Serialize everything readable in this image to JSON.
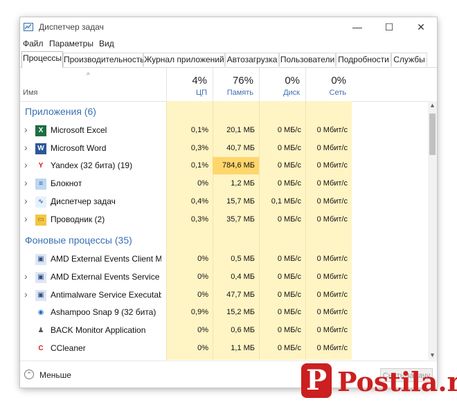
{
  "window": {
    "title": "Диспетчер задач"
  },
  "controls": {
    "minimize": "—",
    "maximize": "☐",
    "close": "✕"
  },
  "menu": [
    "Файл",
    "Параметры",
    "Вид"
  ],
  "tabs": [
    "Процессы",
    "Производительность",
    "Журнал приложений",
    "Автозагрузка",
    "Пользователи",
    "Подробности",
    "Службы"
  ],
  "active_tab": "Процессы",
  "header": {
    "sort_indicator": "^",
    "name_label": "Имя",
    "columns": [
      {
        "pct": "4%",
        "label": "ЦП"
      },
      {
        "pct": "76%",
        "label": "Память"
      },
      {
        "pct": "0%",
        "label": "Диск"
      },
      {
        "pct": "0%",
        "label": "Сеть"
      }
    ]
  },
  "groups": [
    {
      "title": "Приложения (6)",
      "rows": [
        {
          "name": "Microsoft Excel",
          "icon": "excel-icon",
          "expandable": true,
          "cpu": "0,1%",
          "mem": "20,1 МБ",
          "disk": "0 МБ/с",
          "net": "0 Мбит/с"
        },
        {
          "name": "Microsoft Word",
          "icon": "word-icon",
          "expandable": true,
          "cpu": "0,3%",
          "mem": "40,7 МБ",
          "disk": "0 МБ/с",
          "net": "0 Мбит/с"
        },
        {
          "name": "Yandex (32 бита) (19)",
          "icon": "yandex-icon",
          "expandable": true,
          "cpu": "0,1%",
          "mem": "784,6 МБ",
          "disk": "0 МБ/с",
          "net": "0 Мбит/с",
          "mem_hot": true
        },
        {
          "name": "Блокнот",
          "icon": "notepad-icon",
          "expandable": true,
          "cpu": "0%",
          "mem": "1,2 МБ",
          "disk": "0 МБ/с",
          "net": "0 Мбит/с"
        },
        {
          "name": "Диспетчер задач",
          "icon": "taskmgr-icon",
          "expandable": true,
          "cpu": "0,4%",
          "mem": "15,7 МБ",
          "disk": "0,1 МБ/с",
          "net": "0 Мбит/с"
        },
        {
          "name": "Проводник (2)",
          "icon": "explorer-icon",
          "expandable": true,
          "cpu": "0,3%",
          "mem": "35,7 МБ",
          "disk": "0 МБ/с",
          "net": "0 Мбит/с"
        }
      ]
    },
    {
      "title": "Фоновые процессы (35)",
      "rows": [
        {
          "name": "AMD External Events Client Mo...",
          "icon": "service-icon",
          "expandable": false,
          "cpu": "0%",
          "mem": "0,5 МБ",
          "disk": "0 МБ/с",
          "net": "0 Мбит/с"
        },
        {
          "name": "AMD External Events Service M...",
          "icon": "service-icon",
          "expandable": true,
          "cpu": "0%",
          "mem": "0,4 МБ",
          "disk": "0 МБ/с",
          "net": "0 Мбит/с"
        },
        {
          "name": "Antimalware Service Executable",
          "icon": "service-icon",
          "expandable": true,
          "cpu": "0%",
          "mem": "47,7 МБ",
          "disk": "0 МБ/с",
          "net": "0 Мбит/с"
        },
        {
          "name": "Ashampoo Snap 9 (32 бита)",
          "icon": "ashampoo-icon",
          "expandable": false,
          "cpu": "0,9%",
          "mem": "15,2 МБ",
          "disk": "0 МБ/с",
          "net": "0 Мбит/с"
        },
        {
          "name": "BACK Monitor Application",
          "icon": "back-monitor-icon",
          "expandable": false,
          "cpu": "0%",
          "mem": "0,6 МБ",
          "disk": "0 МБ/с",
          "net": "0 Мбит/с"
        },
        {
          "name": "CCleaner",
          "icon": "ccleaner-icon",
          "expandable": false,
          "cpu": "0%",
          "mem": "1,1 МБ",
          "disk": "0 МБ/с",
          "net": "0 Мбит/с"
        }
      ]
    }
  ],
  "footer": {
    "less_label": "Меньше",
    "end_task": "Снять задачу"
  },
  "watermark": {
    "letter": "P",
    "text": "Postila.ru"
  },
  "colors": {
    "accent": "#3a6fb5",
    "heat_light": "#fff4c4",
    "heat_hot": "#ffd66b",
    "watermark": "#cc1f1f"
  }
}
